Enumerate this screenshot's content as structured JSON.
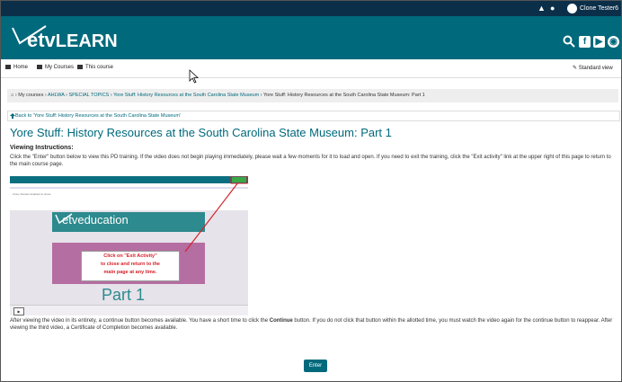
{
  "topbar": {
    "user_name": "Clone Tester6 ⌄",
    "icons": [
      "bell-icon",
      "chat-icon"
    ]
  },
  "banner": {
    "logo_prefix": "etv",
    "logo_suffix": "LEARN",
    "icons": [
      "search-icon",
      "facebook-icon",
      "youtube-icon",
      "web-icon"
    ],
    "bg_color": "#00697c"
  },
  "nav": {
    "home": "Home",
    "my_courses": "My Courses",
    "this_course": "This course",
    "standard_view": "Standard view"
  },
  "breadcrumb": {
    "root": "›",
    "items": [
      "My courses",
      "AHLWA",
      "SPECIAL TOPICS",
      "Yore Stuff: History Resources at the South Carolina State Museum",
      "Yore Stuff: History Resources at the South Carolina State Museum: Part 1"
    ]
  },
  "back_link": "Back to 'Yore Stuff: History Resources at the South Carolina State Museum'",
  "page_title": "Yore Stuff: History Resources at the South Carolina State Museum: Part 1",
  "instructions": {
    "heading": "Viewing Instructions:",
    "paragraph1": "Click the \"Enter\" button below to view this PD training.  If the video does not begin playing immediately, please wait a few moments for it to load and open.  If you need to exit the training, click the \"Exit activity\" link at the upper right of this page to return to the main course page.",
    "paragraph2_part1": "After viewing the video in its entirety, a continue button becomes available.  You have a short time to click the ",
    "paragraph2_bold": "Continue",
    "paragraph2_part2": " button.  If you do not click that button within the allotted time, you must watch the video again for the continue button to reappear.  After viewing the third video, a Certificate of Completion becomes available."
  },
  "screenshot": {
    "tiny_text": "Clone Student Enabled to share",
    "vid_logo_prefix": "etv",
    "vid_logo_suffix": "education",
    "callout_line1": "Click on \"Exit Activity\"",
    "callout_line2": "to close and return to the",
    "callout_line3": "main page at any time.",
    "part_label": "Part 1",
    "play_glyph": "▶"
  },
  "enter_button": "Enter"
}
